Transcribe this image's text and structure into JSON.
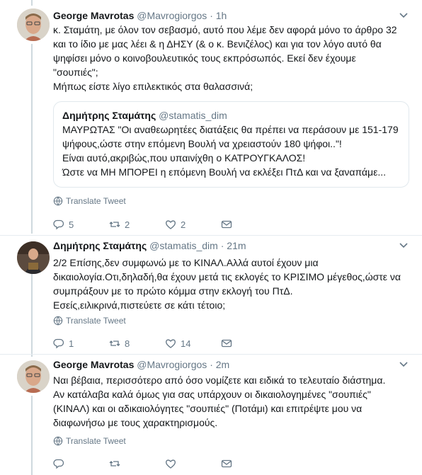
{
  "tweets": [
    {
      "author_name": "George Mavrotas",
      "handle": "@Mavrogiorgos",
      "separator": "·",
      "time": "1h",
      "text_lines": [
        "κ. Σταμάτη, με όλον τον σεβασμό, αυτό που λέμε δεν αφορά μόνο το άρθρο 32",
        "και το ίδιο με μας λέει & η ΔΗΣΥ (& ο κ.  Βενιζέλος) και για τον λόγο αυτό θα",
        "ψηφίσει μόνο ο  κοινοβουλευτικός τους εκπρόσωπός. Εκεί δεν έχουμε",
        "\"σουπιές\";",
        "Μήπως είστε λίγο επιλεκτικός στα θαλασσινά;"
      ],
      "quote": {
        "author_name": "Δημήτρης Σταμάτης",
        "handle": "@stamatis_dim",
        "text_lines": [
          "ΜΑΥΡΩΤΑΣ \"Οι αναθεωρητέες διατάξεις θα πρέπει να περάσουν με 151-179",
          "ψήφους,ώστε στην επόμενη Βουλή να χρειαστούν 180 ψήφοι..\"!",
          "Είναι αυτό,ακριβώς,που υπαινίχθη ο ΚΑΤΡΟΥΓΚΑΛΟΣ!",
          "Ώστε να ΜΗ ΜΠΟΡΕΙ η επόμενη Βουλή να εκλέξει ΠτΔ και να ξαναπάμε..."
        ]
      },
      "translate_label": "Translate Tweet",
      "replies": "5",
      "retweets": "2",
      "likes": "2"
    },
    {
      "author_name": "Δημήτρης Σταμάτης",
      "handle": "@stamatis_dim",
      "separator": "·",
      "time": "21m",
      "text_lines": [
        "2/2  Επίσης,δεν συμφωνώ με το ΚΙΝΑΛ.Αλλά αυτοί έχουν μια",
        "δικαιολογία.Οτι,δηλαδή,θα έχουν μετά τις εκλογές το ΚΡΙΣΙΜΟ μέγεθος,ώστε να",
        "συμπράξουν με το πρώτο κόμμα στην εκλογή του ΠτΔ.",
        "Εσείς,ειλικρινά,πιστεύετε σε κάτι τέτοιο;"
      ],
      "translate_label": "Translate Tweet",
      "replies": "1",
      "retweets": "8",
      "likes": "14"
    },
    {
      "author_name": "George Mavrotas",
      "handle": "@Mavrogiorgos",
      "separator": "·",
      "time": "2m",
      "text_lines": [
        "Ναι βέβαια, περισσότερο από όσο νομίζετε και ειδικά το τελευταίο διάστημα.",
        "Αν κατάλαβα καλά όμως για σας υπάρχουν οι δικαιολογημένες \"σουπιές\"",
        "(ΚΙΝΑΛ) και οι αδικαιολόγητες \"σουπιές\" (Ποτάμι) και επιτρέψτε μου να",
        "διαφωνήσω με τους χαρακτηρισμούς."
      ],
      "translate_label": "Translate Tweet"
    }
  ],
  "icons": {
    "reply": "reply-icon",
    "retweet": "retweet-icon",
    "like": "heart-icon",
    "dm": "envelope-icon",
    "translate": "globe-icon",
    "caret": "chevron-down-icon"
  },
  "colors": {
    "text": "#14171a",
    "secondary": "#657786",
    "thread_line": "#cfd9de",
    "border": "#e1e8ed"
  }
}
